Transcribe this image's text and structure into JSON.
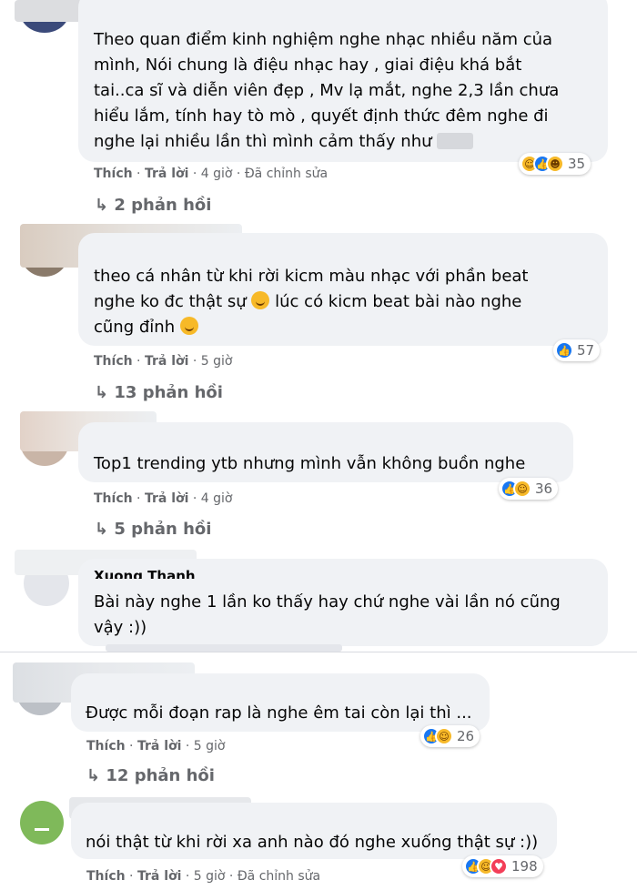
{
  "comments": [
    {
      "lines": [
        "Theo quan điểm kinh nghiệm nghe nhạc nhiều năm của",
        "mình, Nói chung là điệu nhạc hay , giai điệu khá bắt",
        "tai..ca sĩ và diễn viên đẹp , Mv lạ mắt, nghe 2,3 lần chưa",
        "hiểu lắm, tính hay tò mò , quyết định thức đêm nghe đi",
        "nghe lại nhiều lần thì mình cảm thấy như"
      ],
      "like": "Thích",
      "reply": "Trả lời",
      "time": "4 giờ",
      "edited": "Đã chỉnh sửa",
      "reaction_count": "35",
      "replies": "2 phản hồi"
    },
    {
      "lines": [
        "theo cá nhân từ khi rời kicm màu nhạc với phần beat",
        "nghe ko đc thật sự",
        "lúc có kicm beat bài nào nghe",
        "cũng đỉnh"
      ],
      "like": "Thích",
      "reply": "Trả lời",
      "time": "5 giờ",
      "reaction_count": "57",
      "replies": "13 phản hồi"
    },
    {
      "lines": [
        "Top1 trending ytb nhưng mình vẫn không buồn nghe"
      ],
      "like": "Thích",
      "reply": "Trả lời",
      "time": "4 giờ",
      "reaction_count": "36",
      "replies": "5 phản hồi"
    },
    {
      "lines": [
        "Bài này nghe 1 lần ko thấy hay chứ nghe vài lần nó cũng",
        "vậy :))"
      ],
      "partial_name": "Xuong Thanh"
    },
    {
      "lines": [
        "Được mỗi đoạn rap là nghe êm tai còn lại thì ..."
      ],
      "like": "Thích",
      "reply": "Trả lời",
      "time": "5 giờ",
      "reaction_count": "26",
      "replies": "12 phản hồi"
    },
    {
      "lines": [
        "nói thật từ khi rời xa anh nào đó nghe xuống thật sự :))"
      ],
      "like": "Thích",
      "reply": "Trả lời",
      "time": "5 giờ",
      "edited": "Đã chỉnh sửa",
      "reaction_count": "198"
    }
  ],
  "icons": {
    "reply_arrow": "reply-arrow-icon",
    "like": "like-reaction-icon",
    "haha": "haha-reaction-icon",
    "love": "love-reaction-icon"
  },
  "colors": {
    "bubble": "#f0f2f5",
    "meta": "#65676b",
    "like_blue": "#1877f2",
    "haha_yellow": "#f7b928",
    "love_red": "#f33e58"
  }
}
